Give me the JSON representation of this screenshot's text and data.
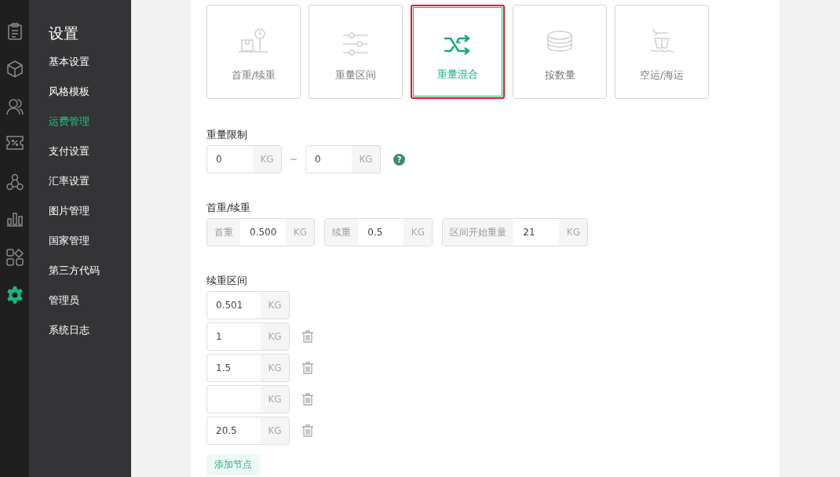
{
  "rail": [
    {
      "kind": "clipboard",
      "selected": false
    },
    {
      "kind": "cube",
      "selected": false
    },
    {
      "kind": "users",
      "selected": false
    },
    {
      "kind": "coupon",
      "selected": false
    },
    {
      "kind": "nodes",
      "selected": false
    },
    {
      "kind": "chart",
      "selected": false
    },
    {
      "kind": "apps",
      "selected": false
    },
    {
      "kind": "gear",
      "selected": true
    }
  ],
  "sidebar": {
    "title": "设置",
    "items": [
      {
        "label": "基本设置",
        "selected": false
      },
      {
        "label": "风格模板",
        "selected": false
      },
      {
        "label": "运费管理",
        "selected": true
      },
      {
        "label": "支付设置",
        "selected": false
      },
      {
        "label": "汇率设置",
        "selected": false
      },
      {
        "label": "图片管理",
        "selected": false
      },
      {
        "label": "国家管理",
        "selected": false
      },
      {
        "label": "第三方代码",
        "selected": false
      },
      {
        "label": "管理员",
        "selected": false
      },
      {
        "label": "系统日志",
        "selected": false
      }
    ]
  },
  "modes": [
    {
      "kind": "scale",
      "label": "首重/续重",
      "selected": false
    },
    {
      "kind": "sliders",
      "label": "重量区间",
      "selected": false
    },
    {
      "kind": "shuffle",
      "label": "重量混合",
      "selected": true
    },
    {
      "kind": "stack",
      "label": "按数量",
      "selected": false
    },
    {
      "kind": "plane-ship",
      "label": "空运/海运",
      "selected": false
    }
  ],
  "weight_limit": {
    "label": "重量限制",
    "min": {
      "value": "0",
      "unit": "KG"
    },
    "separator": "~",
    "max": {
      "value": "0",
      "unit": "KG"
    },
    "help": "?"
  },
  "first_continued": {
    "label": "首重/续重",
    "fields": [
      {
        "prefix": "首重",
        "value": "0.500",
        "unit": "KG"
      },
      {
        "prefix": "续重",
        "value": "0.5",
        "unit": "KG"
      },
      {
        "prefix": "区间开始重量",
        "value": "21",
        "unit": "KG"
      }
    ]
  },
  "intervals": {
    "label": "续重区间",
    "rows": [
      {
        "value": "0.501",
        "unit": "KG",
        "deletable": false
      },
      {
        "value": "1",
        "unit": "KG",
        "deletable": true
      },
      {
        "value": "1.5",
        "unit": "KG",
        "deletable": true
      },
      {
        "unit": "KG",
        "deletable": true
      },
      {
        "value": "20.5",
        "unit": "KG",
        "deletable": true
      }
    ],
    "add_button": "添加节点"
  }
}
